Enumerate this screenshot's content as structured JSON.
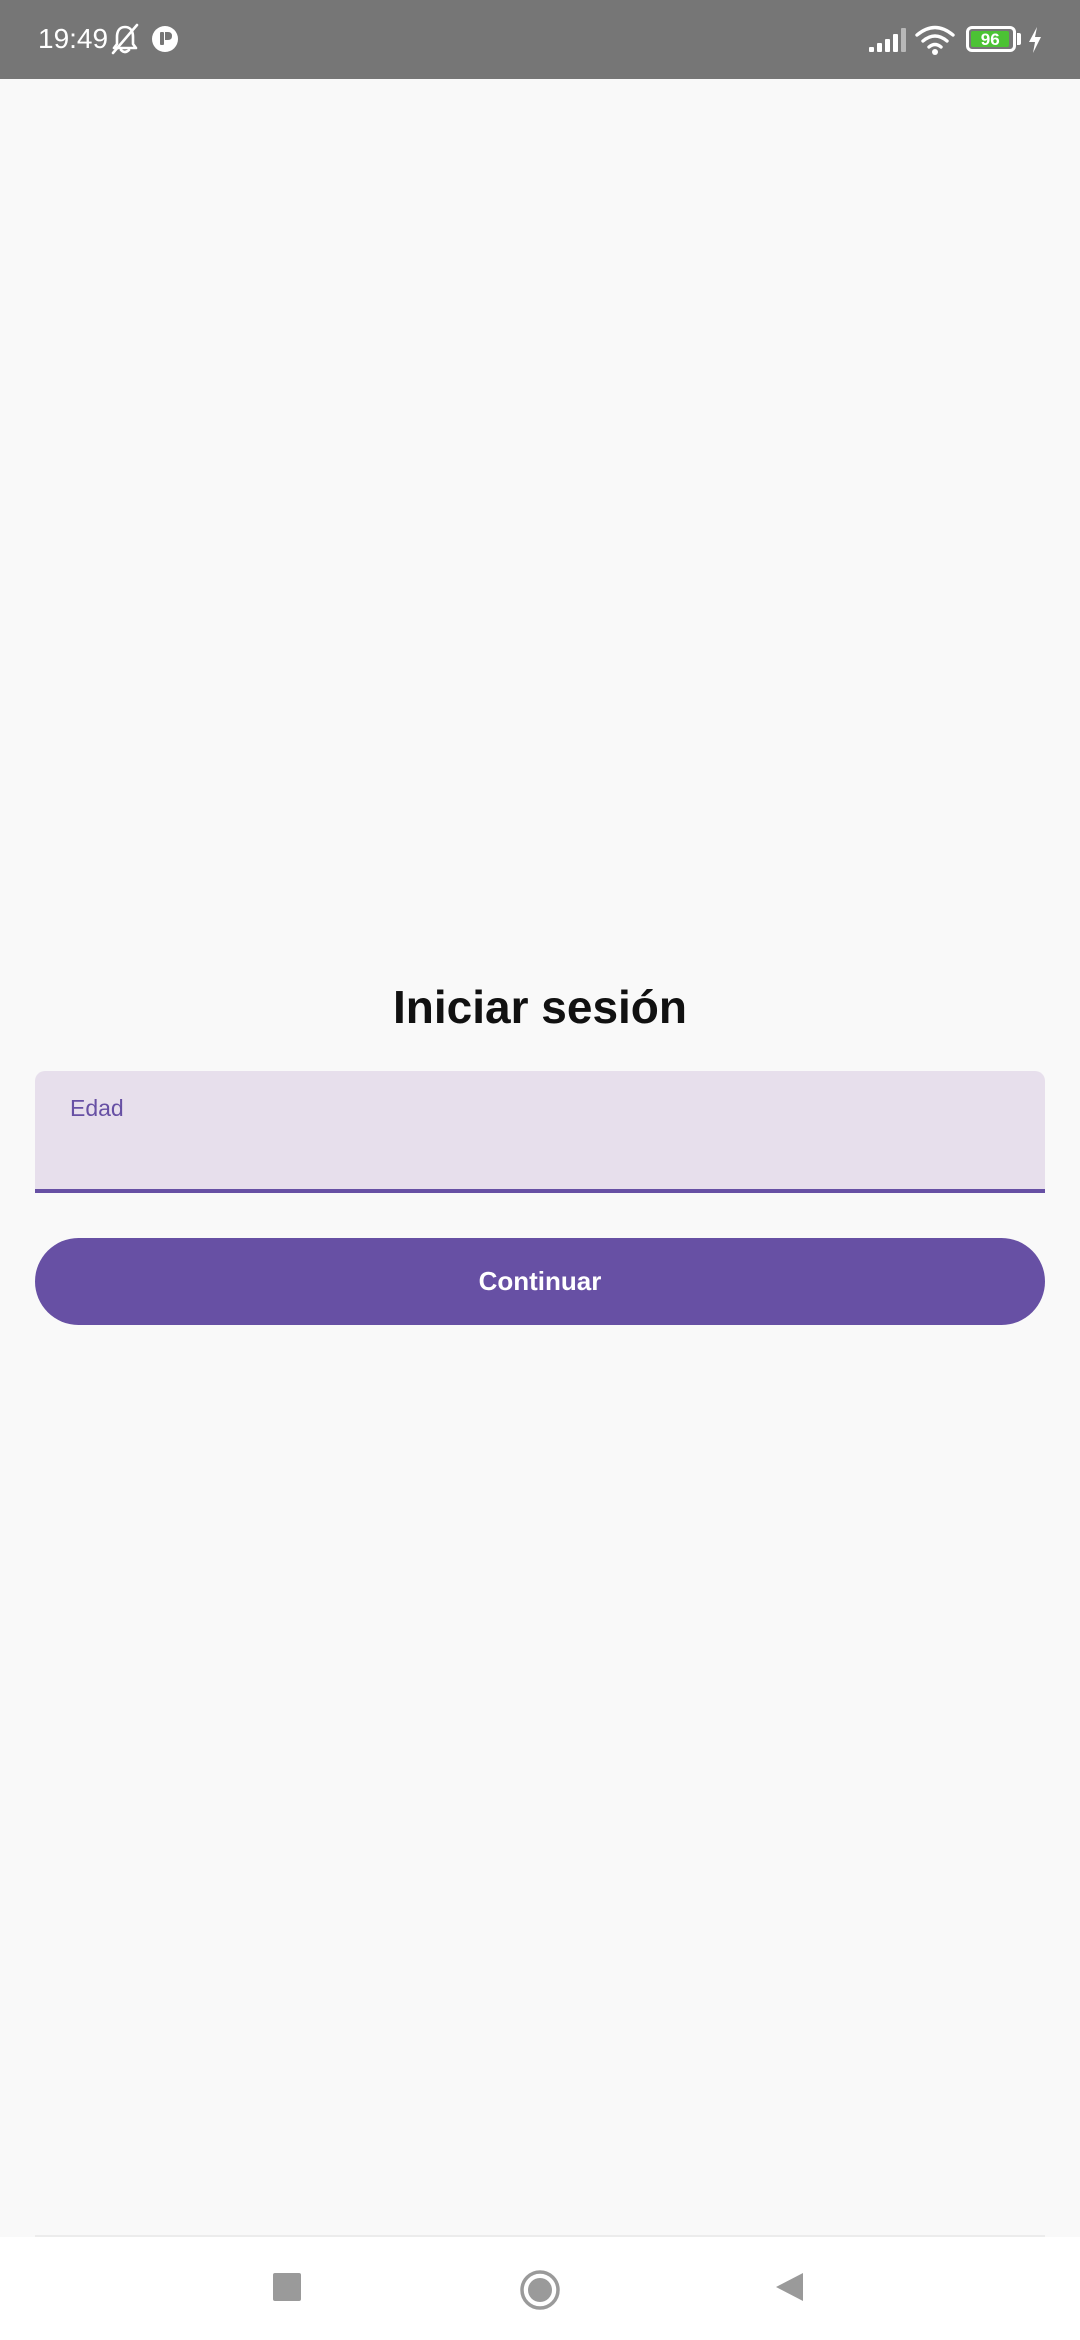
{
  "status_bar": {
    "time": "19:49",
    "battery_level": "96",
    "battery_fraction": 0.96,
    "icons": [
      "bell-off-icon",
      "app-notification-icon",
      "signal-icon",
      "wifi-icon",
      "battery-icon",
      "charging-icon"
    ],
    "background_color": "#767676"
  },
  "login": {
    "title": "Iniciar sesión",
    "age_field": {
      "label": "Edad",
      "value": ""
    },
    "continue_button": "Continuar"
  },
  "nav_bar": {
    "buttons": [
      "recents-icon",
      "home-icon",
      "back-icon"
    ]
  },
  "colors": {
    "primary": "#6750a4",
    "field_background": "#e7dfec",
    "page_background": "#f9f9f9",
    "battery_fill": "#4cc234"
  }
}
